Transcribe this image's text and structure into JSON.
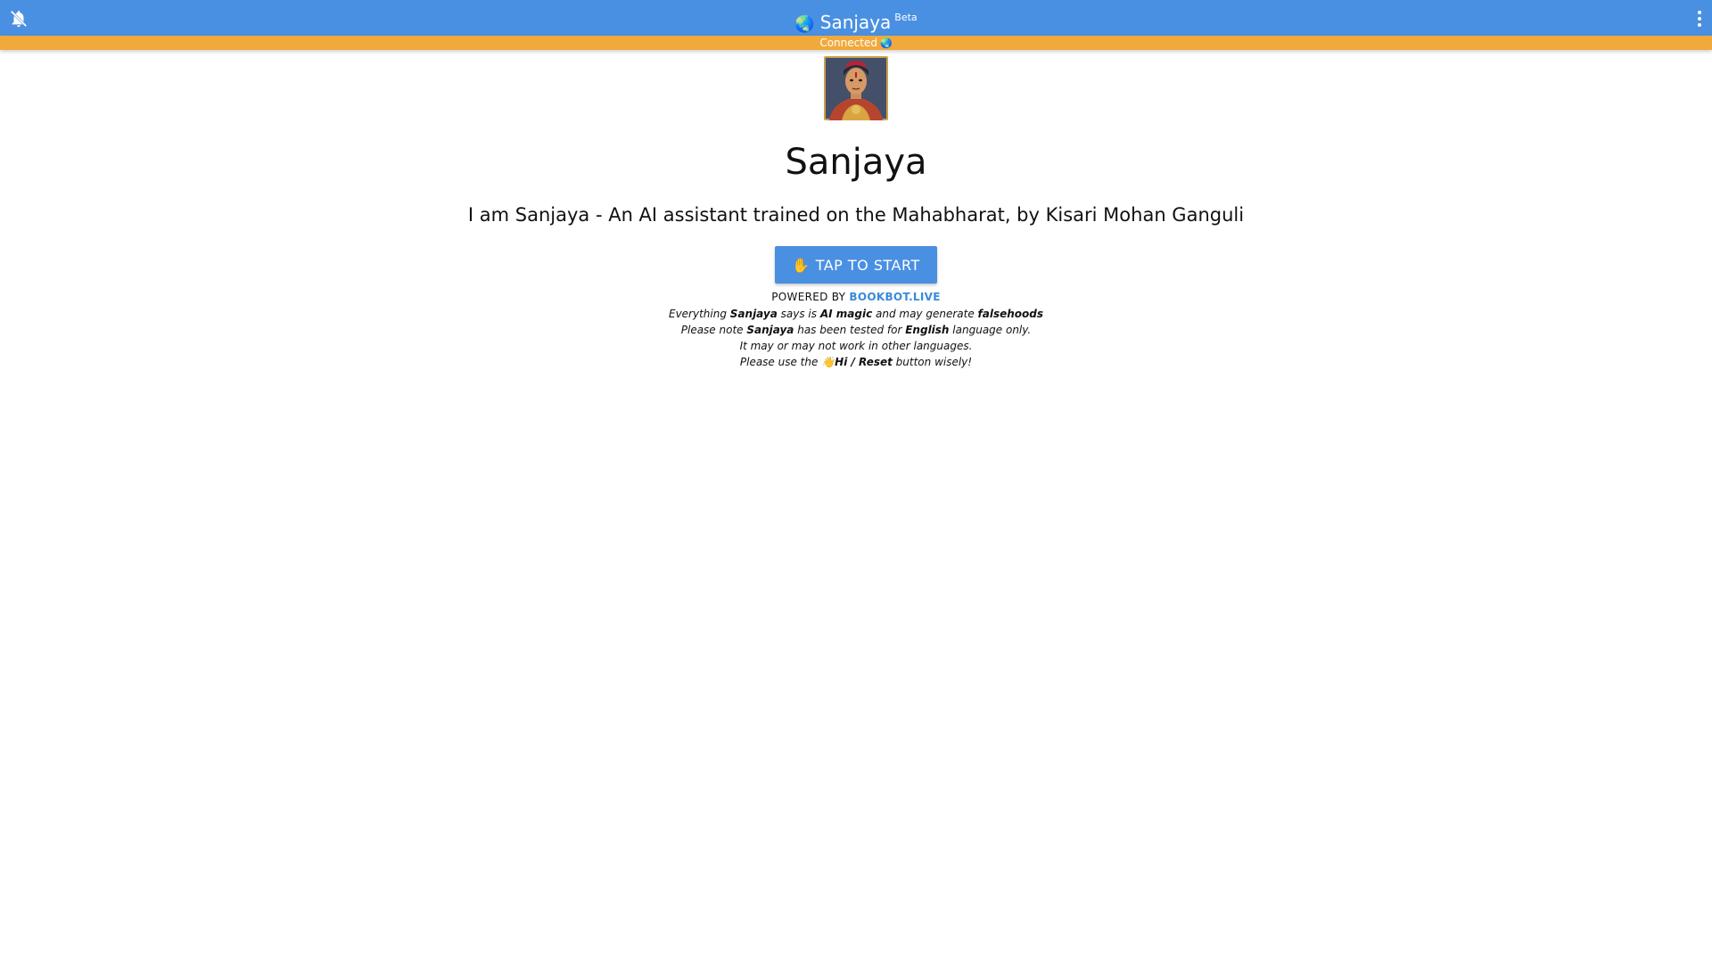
{
  "header": {
    "title": "Sanjaya",
    "badge": "Beta",
    "globe_icon": "🌏",
    "bell_icon": "bell-off-icon",
    "menu_icon": "more-vertical-icon",
    "bg_color": "#4a90e2"
  },
  "status": {
    "text": "Connected",
    "globe_icon": "🌏",
    "bg_color": "#f1a93b"
  },
  "main": {
    "avatar_icon": "sanjaya-portrait",
    "title": "Sanjaya",
    "subtitle": "I am Sanjaya - An AI assistant trained on the Mahabharat, by Kisari Mohan Ganguli",
    "start_button": {
      "hand_icon": "✋",
      "label": "TAP TO START"
    },
    "powered_by": {
      "prefix": "POWERED BY",
      "link_text": "BOOKBOT.LIVE"
    },
    "disclaimer": {
      "line1_a": "Everything ",
      "line1_b": "Sanjaya",
      "line1_c": " says is ",
      "line1_d": "AI magic",
      "line1_e": " and may generate ",
      "line1_f": "falsehoods",
      "line2_a": "Please note ",
      "line2_b": "Sanjaya",
      "line2_c": " has been tested for ",
      "line2_d": "English",
      "line2_e": " language only.",
      "line3": "It may or may not work in other languages.",
      "line4_a": "Please use the ",
      "line4_icon": "👋",
      "line4_b": "Hi / Reset",
      "line4_c": " button wisely!"
    }
  }
}
